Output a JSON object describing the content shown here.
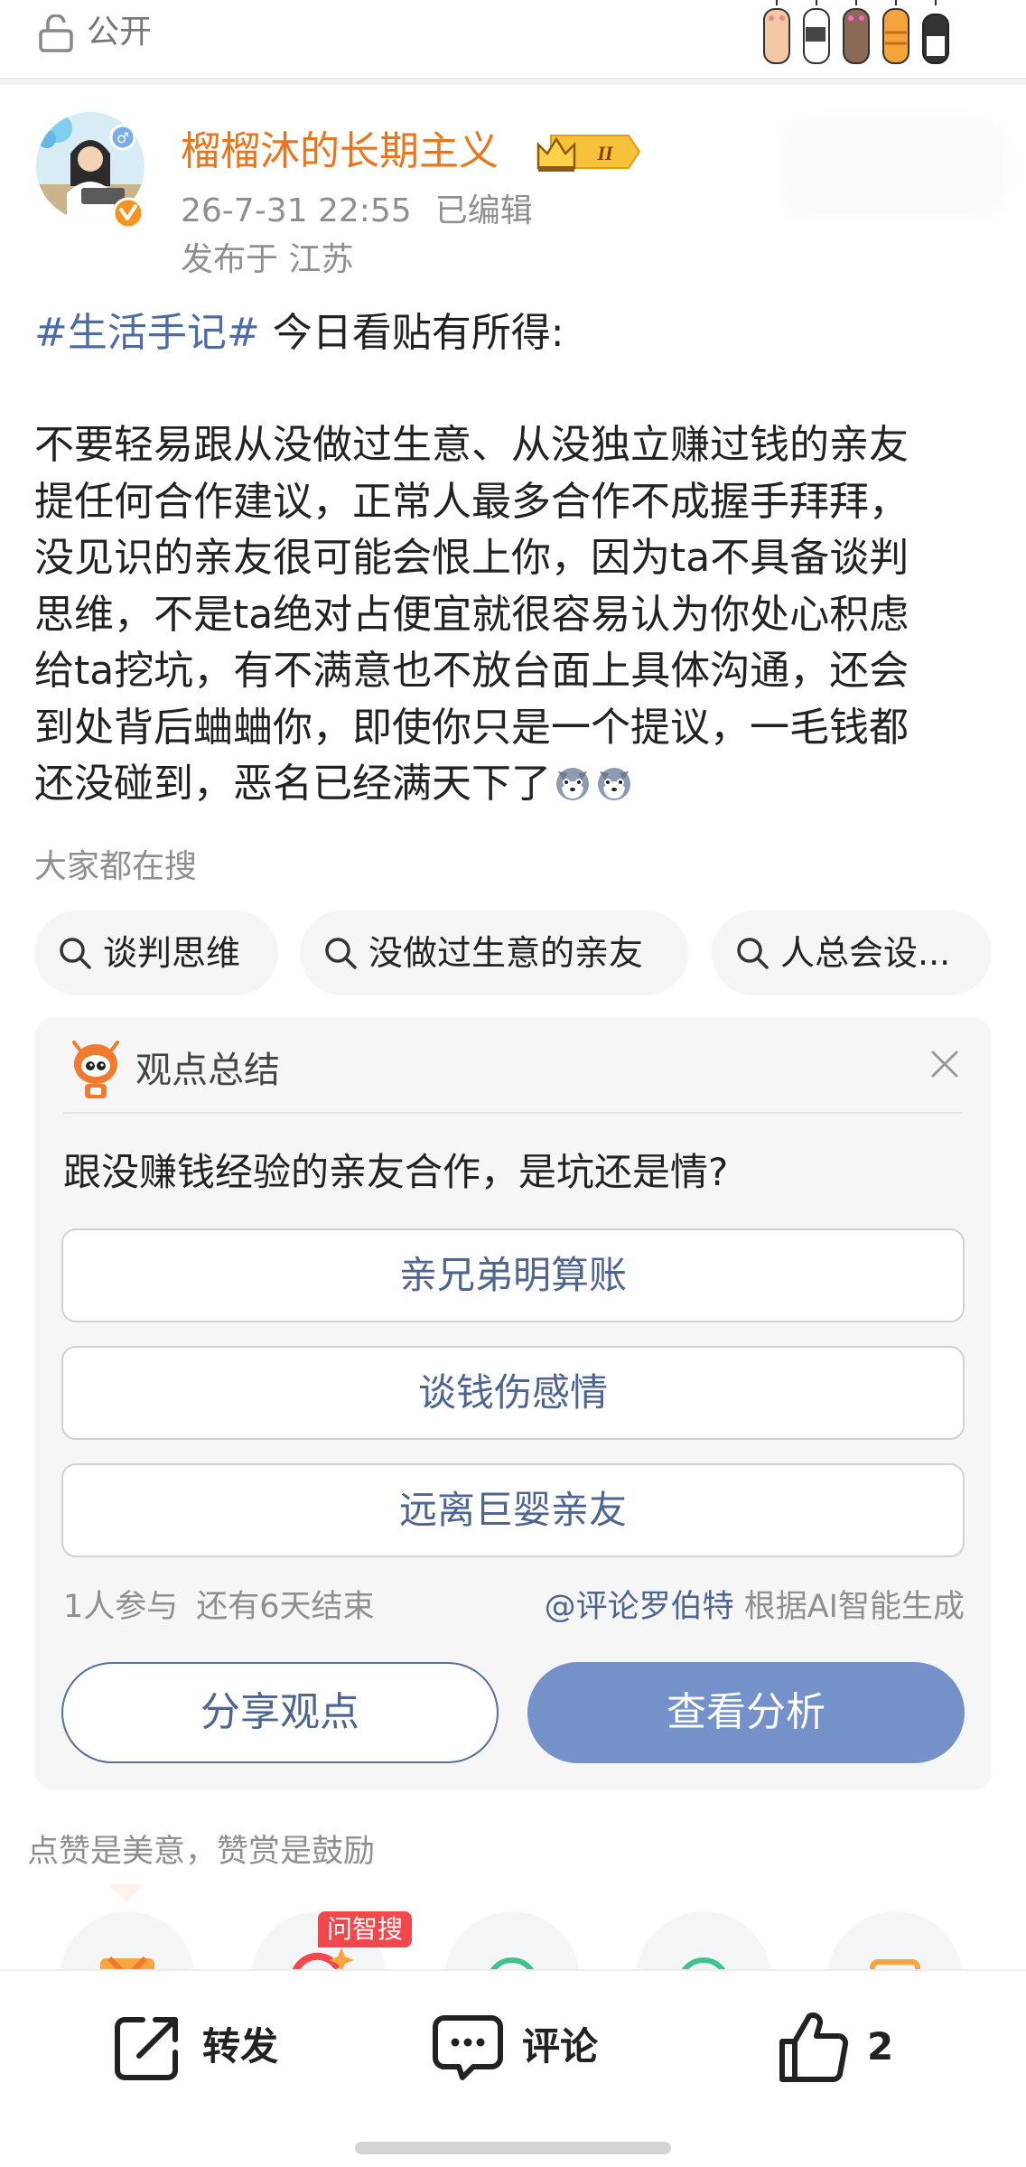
{
  "header": {
    "visibility_label": "公开",
    "lock_icon": "lock-open-icon",
    "decoration": "cat-paws-decoration"
  },
  "author": {
    "name": "榴榴沐的长期主义",
    "level_badge": "II",
    "verified_badge": "v",
    "timestamp": "26-7-31 22:55",
    "edited_label": "已编辑",
    "location": "发布于 江苏"
  },
  "post": {
    "hashtag": "#生活手记#",
    "intro": " 今日看贴有所得:",
    "lines": [
      "不要轻易跟从没做过生意、从没独立赚过钱的亲友",
      "提任何合作建议，正常人最多合作不成握手拜拜，",
      "没见识的亲友很可能会恨上你，因为ta不具备谈判",
      "思维，不是ta绝对占便宜就很容易认为你处心积虑",
      "给ta挖坑，有不满意也不放台面上具体沟通，还会",
      "到处背后蛐蛐你，即使你只是一个提议，一毛钱都",
      "还没碰到，恶名已经满天下了"
    ],
    "emoji": "husky-face-emoji"
  },
  "search": {
    "title": "大家都在搜",
    "chips": [
      "谈判思维",
      "没做过生意的亲友",
      "人总会设..."
    ]
  },
  "summary": {
    "title": "观点总结",
    "question": "跟没赚钱经验的亲友合作，是坑还是情?",
    "options": [
      "亲兄弟明算账",
      "谈钱伤感情",
      "远离巨婴亲友"
    ],
    "participants": "1人参与",
    "remaining": "还有6天结束",
    "author_mention": "@评论罗伯特",
    "ai_note": " 根据AI智能生成",
    "share_label": "分享观点",
    "view_label": "查看分析"
  },
  "appreciation": {
    "text": "点赞是美意，赞赏是鼓励",
    "badge": "问智搜"
  },
  "actions": {
    "repost_label": "转发",
    "comment_label": "评论",
    "like_count": "2"
  },
  "colors": {
    "username": "#e8761e",
    "link": "#4d6ba6",
    "primary_button": "#7591c9",
    "meta_text": "#8f8f8f"
  }
}
